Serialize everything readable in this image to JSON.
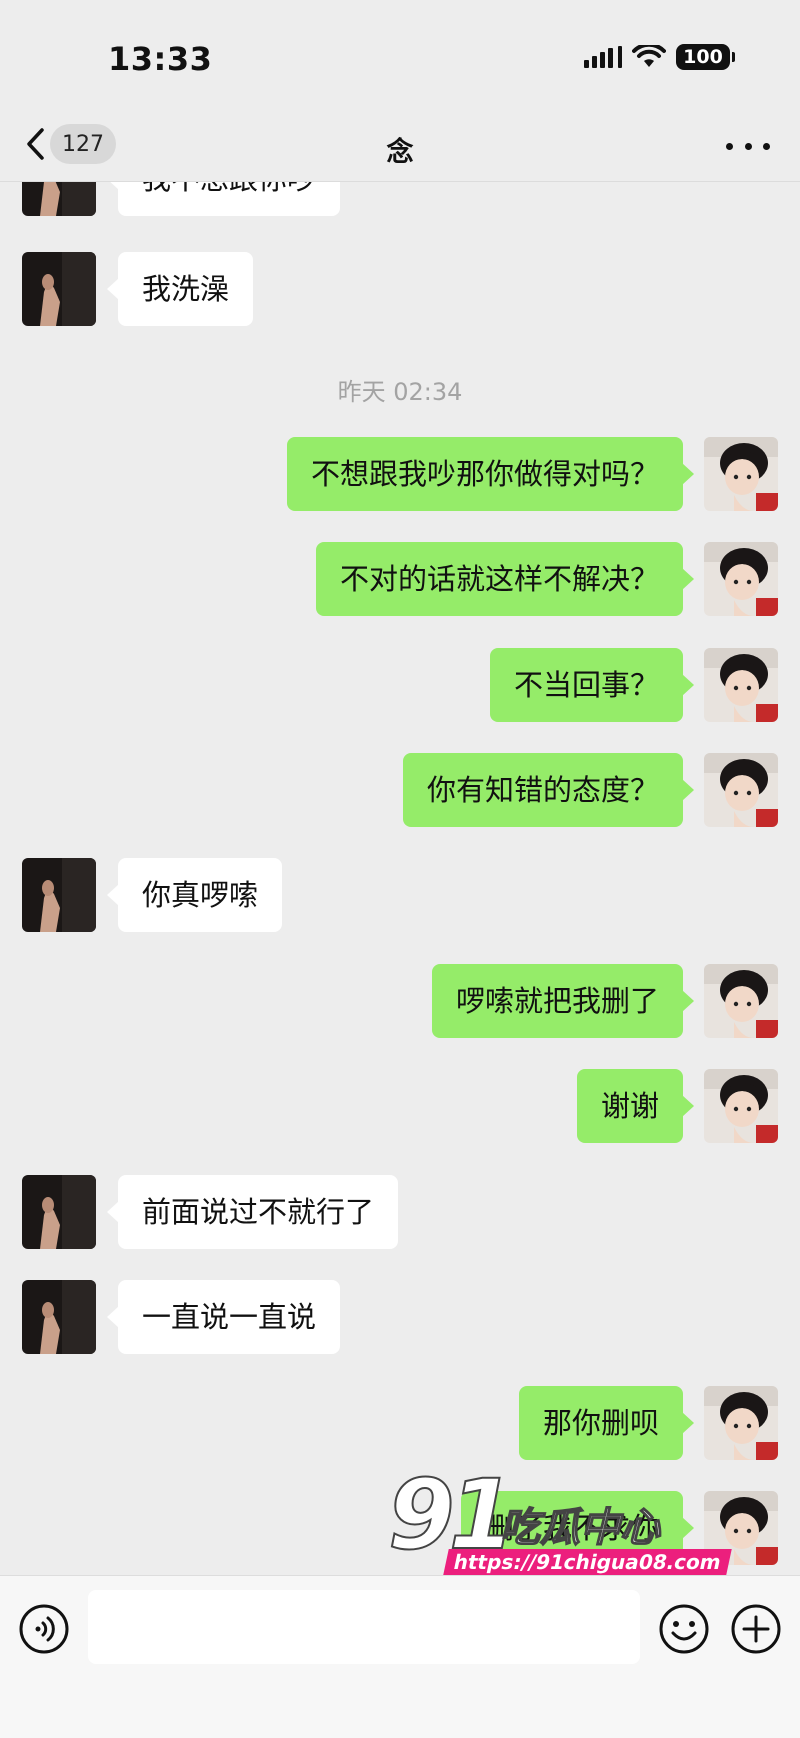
{
  "status_bar": {
    "time": "13:33",
    "battery": "100"
  },
  "nav": {
    "back_count": "127",
    "title": "念"
  },
  "chat": {
    "timestamp": "昨天 02:34",
    "messages": [
      {
        "side": "left",
        "text": "我不想跟你吵"
      },
      {
        "side": "left",
        "text": "我洗澡"
      },
      {
        "side": "right",
        "text": "不想跟我吵那你做得对吗？"
      },
      {
        "side": "right",
        "text": "不对的话就这样不解决？"
      },
      {
        "side": "right",
        "text": "不当回事？"
      },
      {
        "side": "right",
        "text": "你有知错的态度？"
      },
      {
        "side": "left",
        "text": "你真啰嗦"
      },
      {
        "side": "right",
        "text": "啰嗦就把我删了"
      },
      {
        "side": "right",
        "text": "谢谢"
      },
      {
        "side": "left",
        "text": "前面说过不就行了"
      },
      {
        "side": "left",
        "text": "一直说一直说"
      },
      {
        "side": "right",
        "text": "那你删呗"
      },
      {
        "side": "right",
        "text": "删了我不求你"
      }
    ]
  },
  "watermark": {
    "number": "91",
    "name": "吃瓜中心",
    "url": "https://91chigua08.com"
  },
  "input_bar": {
    "placeholder": ""
  },
  "colors": {
    "background": "#ededed",
    "sent_bubble": "#95ec69",
    "received_bubble": "#ffffff",
    "watermark_url_bg": "#ec1f7d"
  }
}
